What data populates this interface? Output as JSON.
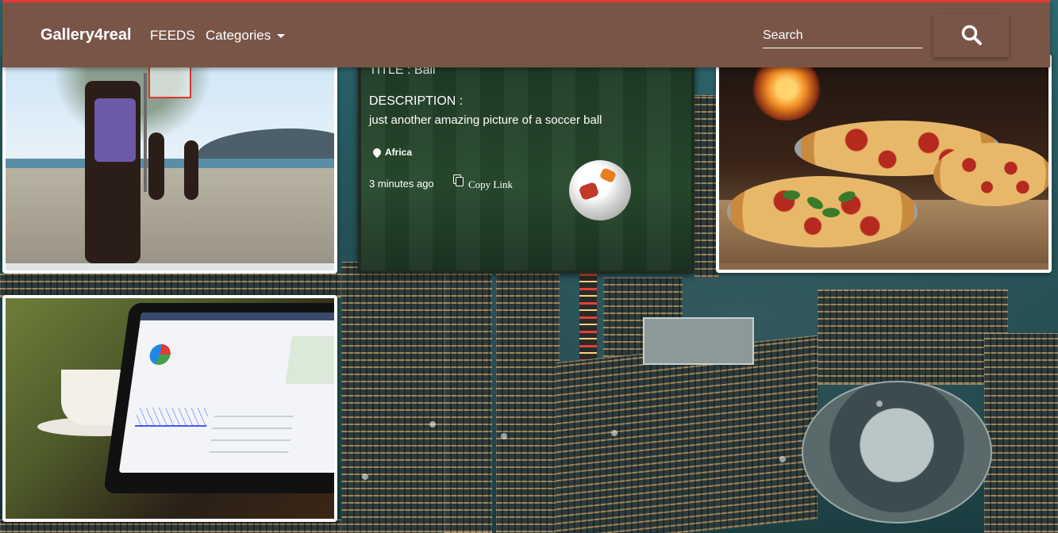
{
  "navbar": {
    "brand": "Gallery4real",
    "feeds_label": "FEEDS",
    "categories_label": "Categories",
    "search_placeholder": "Search",
    "bg_color": "#795548",
    "accent_color": "#e53935"
  },
  "gallery": {
    "featured": {
      "title_line": "TITLE : Ball",
      "description_label": "DESCRIPTION :",
      "description": "just another amazing picture of a soccer ball",
      "location": "Africa",
      "time_ago": "3 minutes ago",
      "copy_link_label": "Copy Link"
    },
    "photos": [
      {
        "subject": "basketball court by the sea"
      },
      {
        "subject": "pizzas on a wooden table"
      },
      {
        "subject": "tablet showing analytics dashboard"
      }
    ]
  },
  "icons": {
    "search": "search-icon",
    "location": "map-pin-icon",
    "copy": "copy-icon",
    "dropdown": "caret-down-icon"
  }
}
